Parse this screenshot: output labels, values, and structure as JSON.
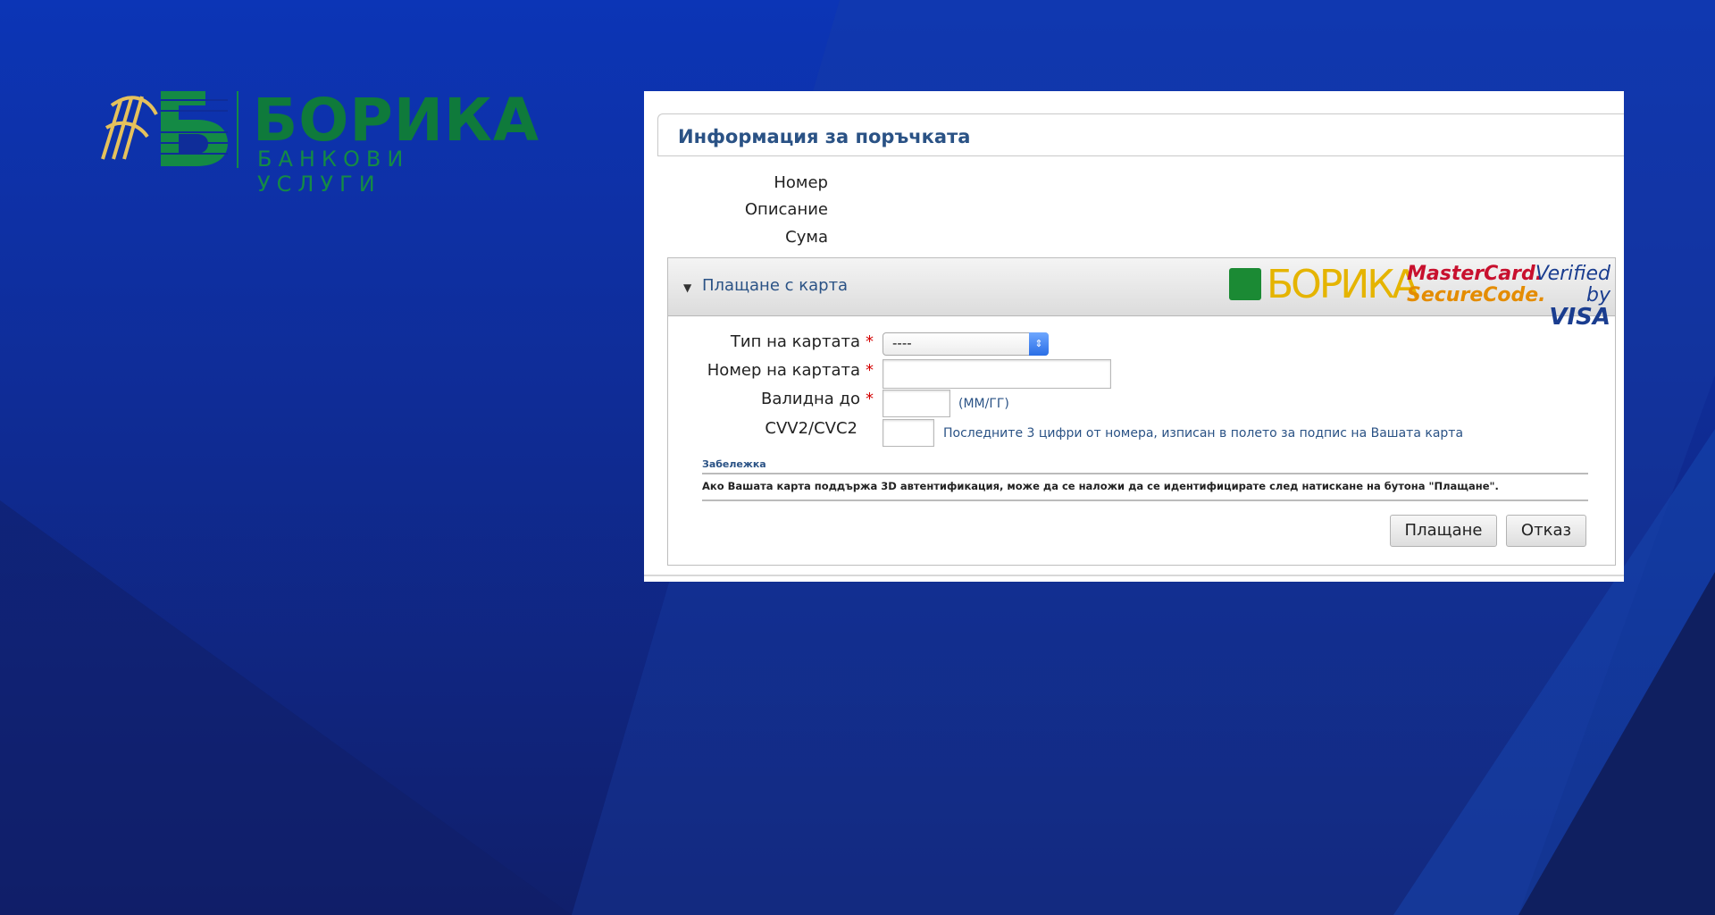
{
  "logo": {
    "title": "БОРИКА",
    "subtitle": "БАНКОВИ УСЛУГИ",
    "brand_color": "#0f7a3b",
    "accent_color": "#e5c15c"
  },
  "order": {
    "title": "Информация за поръчката",
    "number_label": "Номер",
    "description_label": "Описание",
    "amount_label": "Сума"
  },
  "card": {
    "header_label": "Плащане с карта",
    "expand_icon": "triangle-down-icon",
    "brand_logos": {
      "borica_text": "БОРИКА",
      "mastercard_line1": "MasterCard.",
      "mastercard_line2": "SecureCode.",
      "visa_line1": "Verified by",
      "visa_line2": "VISA"
    },
    "fields": {
      "type_label": "Тип на картата",
      "type_value": "----",
      "number_label": "Номер на картата",
      "expiry_label": "Валидна до",
      "expiry_hint": "(ММ/ГГ)",
      "cvv_label": "CVV2/CVC2",
      "cvv_hint": "Последните 3 цифри от номера, изписан в полето за подпис на Вашата карта",
      "required_mark": "*"
    },
    "note": {
      "title": "Забележка",
      "text": "Ако Вашата карта поддържа 3D автентификация, може да се наложи да се идентифицирате след натискане на бутона \"Плащане\"."
    },
    "buttons": {
      "pay": "Плащане",
      "cancel": "Отказ"
    }
  }
}
